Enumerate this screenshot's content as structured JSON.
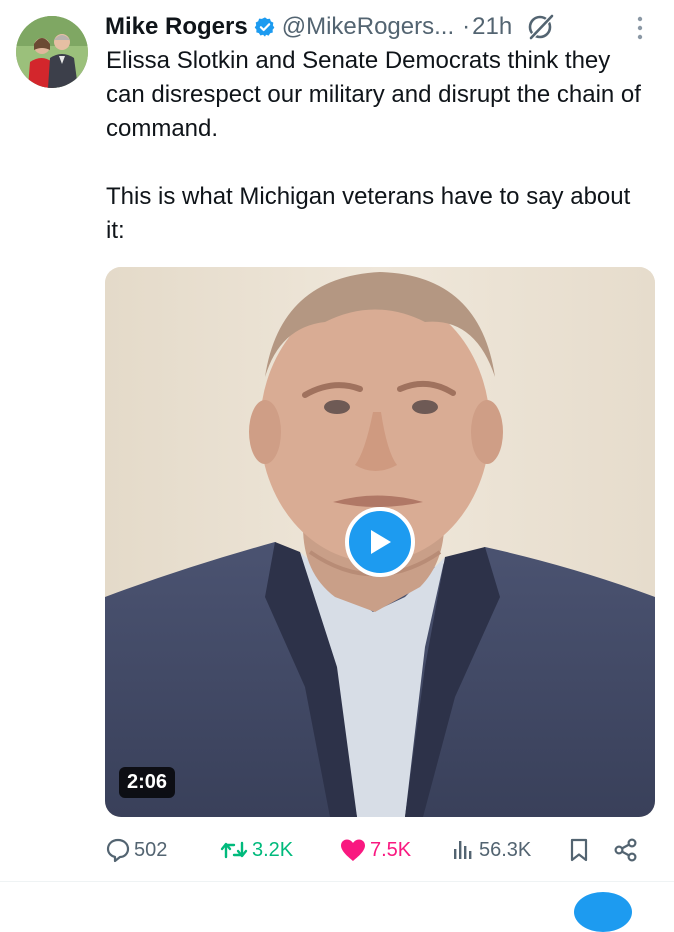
{
  "tweet": {
    "author_name": "Mike Rogers",
    "handle": "@MikeRogers...",
    "separator": "·",
    "time_ago": "21h",
    "text_paragraphs": [
      "Elissa Slotkin and Senate Democrats think they can disrespect our military and disrupt the chain of command.",
      "This is what Michigan veterans have to say about it:"
    ],
    "media": {
      "type": "video",
      "duration": "2:06"
    },
    "actions": {
      "replies": "502",
      "reposts": "3.2K",
      "likes": "7.5K",
      "views": "56.3K"
    },
    "icons": {
      "verified": "verified-badge-icon",
      "grok": "grok-icon",
      "more": "more-vertical-icon",
      "reply": "reply-icon",
      "repost": "repost-icon",
      "like": "heart-icon",
      "views": "views-icon",
      "bookmark": "bookmark-icon",
      "share": "share-icon"
    },
    "colors": {
      "accent": "#1d9bf0",
      "repost_active": "#00ba7c",
      "like_active": "#f91880",
      "secondary_text": "#536471"
    }
  }
}
